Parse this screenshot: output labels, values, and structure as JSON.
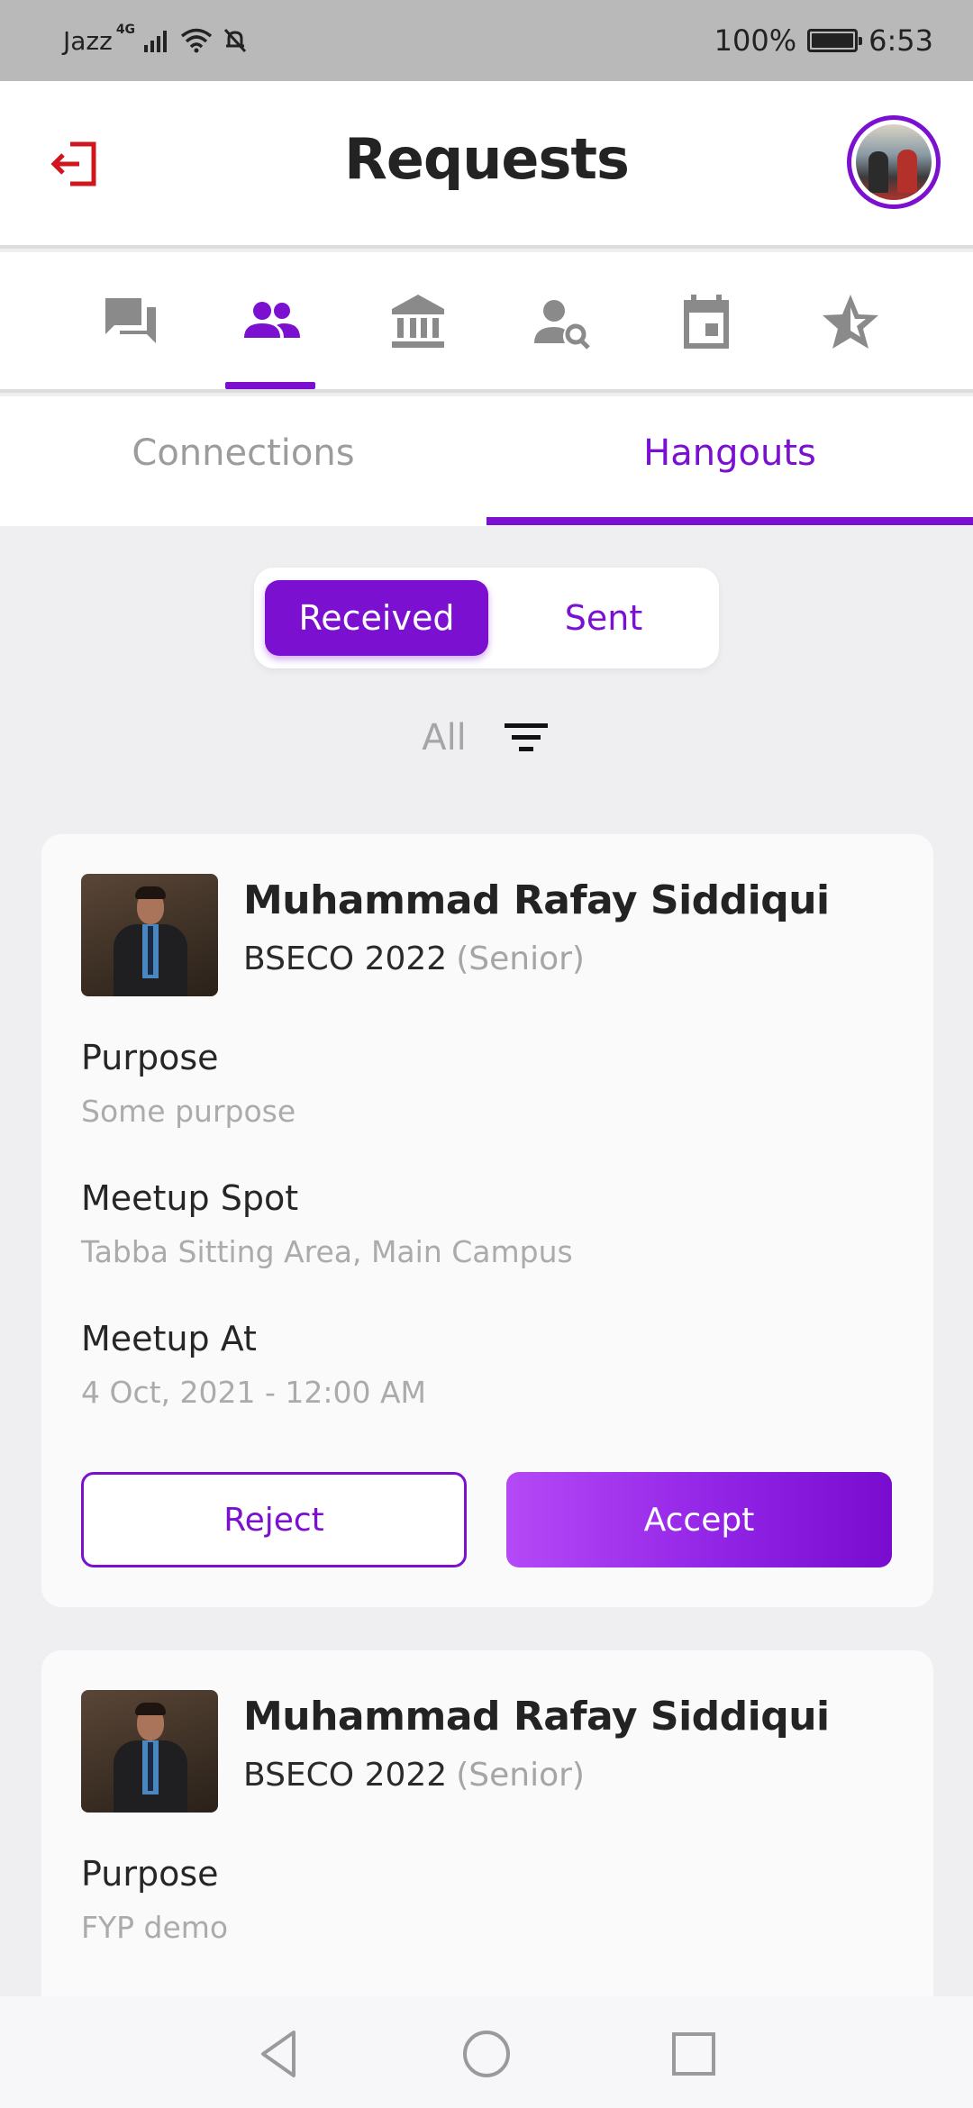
{
  "status_bar": {
    "carrier": "Jazz",
    "network": "4G",
    "battery": "100%",
    "time": "6:53"
  },
  "header": {
    "title": "Requests",
    "logout_icon": "logout-icon",
    "accent_color": "#7b10d0"
  },
  "icon_nav": {
    "items": [
      {
        "icon": "chat-icon",
        "active": false
      },
      {
        "icon": "people-icon",
        "active": true
      },
      {
        "icon": "institution-icon",
        "active": false
      },
      {
        "icon": "person-search-icon",
        "active": false
      },
      {
        "icon": "calendar-icon",
        "active": false
      },
      {
        "icon": "star-icon",
        "active": false
      }
    ]
  },
  "tabs": {
    "connections": "Connections",
    "hangouts": "Hangouts",
    "active": "hangouts"
  },
  "segment": {
    "received": "Received",
    "sent": "Sent",
    "active": "received"
  },
  "filter": {
    "label": "All",
    "icon": "filter-icon"
  },
  "requests": [
    {
      "name": "Muhammad Rafay Siddiqui",
      "program": "BSECO 2022",
      "level": "(Senior)",
      "purpose_label": "Purpose",
      "purpose": "Some purpose",
      "spot_label": "Meetup Spot",
      "spot": "Tabba Sitting Area, Main Campus",
      "time_label": "Meetup At",
      "time": "4 Oct, 2021 - 12:00 AM",
      "reject_label": "Reject",
      "accept_label": "Accept"
    },
    {
      "name": "Muhammad Rafay Siddiqui",
      "program": "BSECO 2022",
      "level": "(Senior)",
      "purpose_label": "Purpose",
      "purpose": "FYP demo"
    }
  ]
}
